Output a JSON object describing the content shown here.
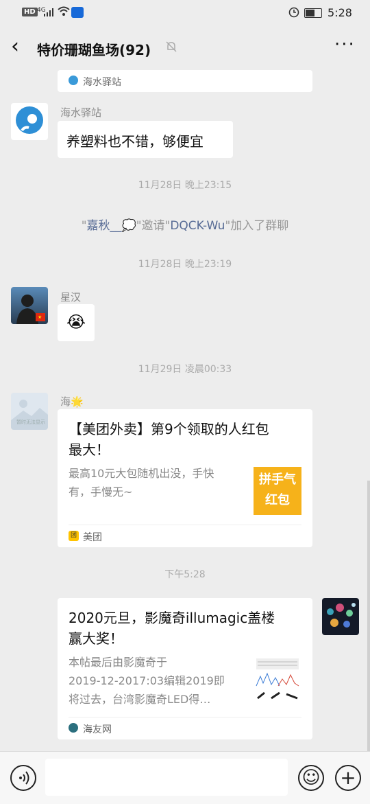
{
  "status_bar": {
    "hd": "HD",
    "network": "4G",
    "time": "5:28"
  },
  "header": {
    "back_icon": "‹",
    "title": "特价珊瑚鱼场(92)",
    "mute_icon": "bell-off-icon",
    "more_icon": "···"
  },
  "messages": {
    "top_card_source": "海水驿站",
    "msg1": {
      "sender": "海水驿站",
      "text": "养塑料也不错，够便宜"
    },
    "ts1": "11月28日 晚上23:15",
    "system": {
      "q1": "\"",
      "inviter": "嘉秋__",
      "q2": "\"邀请\"",
      "invitee": "DQCK-Wu",
      "q3": "\"加入了群聊"
    },
    "ts2": "11月28日 晚上23:19",
    "msg2": {
      "sender": "星汉",
      "emoji": "😭"
    },
    "ts3": "11月29日 凌晨00:33",
    "msg3": {
      "sender": "海🌟",
      "avatar_caption": "暂时无法显示",
      "title_line1": "【美团外卖】第9个领取的人红包",
      "title_line2": "最大！",
      "desc_line1": "最高10元大包随机出没，手快",
      "desc_line2": "有，手慢无~",
      "thumb_text1": "拼手气",
      "thumb_text2": "红包",
      "source": "美团",
      "source_icon": "团"
    },
    "ts4": "下午5:28",
    "msg4": {
      "title_line1": "2020元旦，影魔奇illumagic盖楼",
      "title_line2": "赢大奖！",
      "desc_line1": "本帖最后由影魔奇于",
      "desc_line2": "2019-12-2017:03编辑2019即",
      "desc_line3": "将过去，台湾影魔奇LED得…",
      "source": "海友网"
    }
  },
  "input_bar": {
    "voice_icon": "voice-icon",
    "emoji_icon": "☺",
    "plus_icon": "+"
  }
}
